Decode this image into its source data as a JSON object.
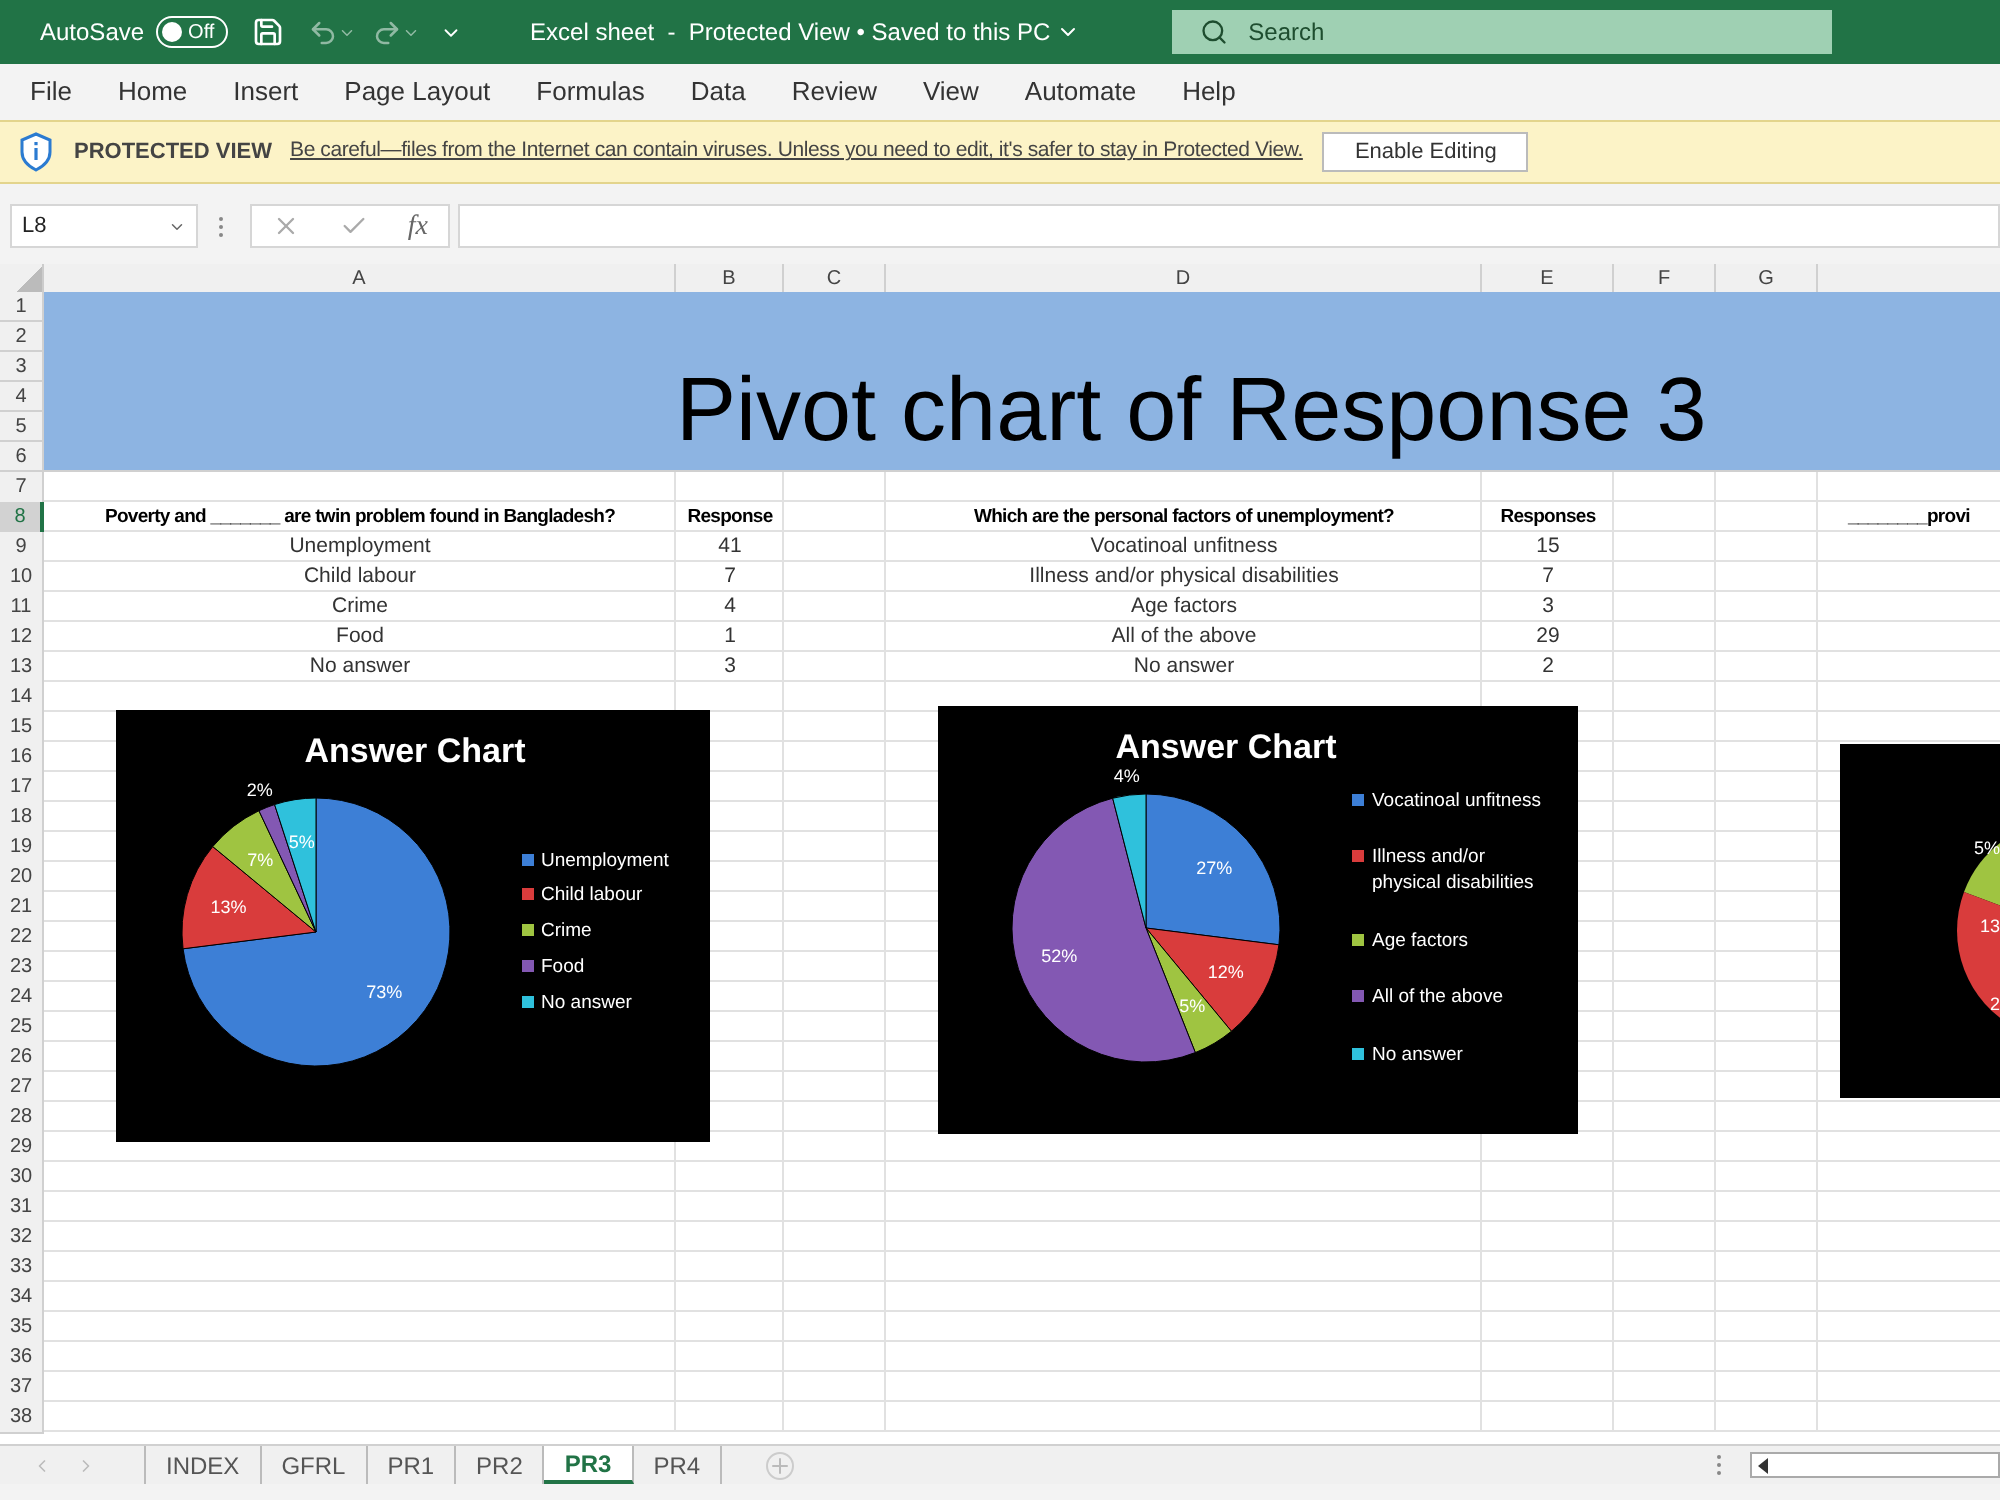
{
  "title_bar": {
    "autosave_label": "AutoSave",
    "autosave_toggle": {
      "label": "Off",
      "on": false
    },
    "title": "Excel sheet  -  Protected View • Saved to this PC",
    "search_placeholder": "Search"
  },
  "menu": [
    "File",
    "Home",
    "Insert",
    "Page Layout",
    "Formulas",
    "Data",
    "Review",
    "View",
    "Automate",
    "Help"
  ],
  "protected_bar": {
    "label": "PROTECTED VIEW",
    "message": "Be careful—files from the Internet can contain viruses. Unless you need to edit, it's safer to stay in Protected View.",
    "button": "Enable Editing"
  },
  "formula_bar": {
    "name_box": "L8",
    "fx": "fx"
  },
  "columns": [
    "A",
    "B",
    "C",
    "D",
    "E",
    "F",
    "G"
  ],
  "banner": {
    "title": "Pivot chart of Response 3"
  },
  "rows": [
    {
      "number": "1",
      "selected": false
    },
    {
      "number": "2",
      "selected": false
    },
    {
      "number": "3",
      "selected": false
    },
    {
      "number": "4",
      "selected": false
    },
    {
      "number": "5",
      "selected": false
    },
    {
      "number": "6",
      "selected": false
    },
    {
      "number": "7",
      "selected": false
    },
    {
      "number": "8",
      "selected": true,
      "kind": "header",
      "cells": {
        "A": "Poverty and _______ are twin problem found in Bangladesh?",
        "B": "Response",
        "D": "Which are the personal factors of unemployment?",
        "E": "Responses",
        "H": "________provi"
      }
    },
    {
      "number": "9",
      "selected": false,
      "kind": "data",
      "cells": {
        "A": "Unemployment",
        "B": "41",
        "D": "Vocatinoal unfitness",
        "E": "15"
      }
    },
    {
      "number": "10",
      "selected": false,
      "kind": "data",
      "cells": {
        "A": "Child labour",
        "B": "7",
        "D": "Illness and/or physical disabilities",
        "E": "7"
      }
    },
    {
      "number": "11",
      "selected": false,
      "kind": "data",
      "cells": {
        "A": "Crime",
        "B": "4",
        "D": "Age factors",
        "E": "3"
      }
    },
    {
      "number": "12",
      "selected": false,
      "kind": "data",
      "cells": {
        "A": "Food",
        "B": "1",
        "D": "All of the above",
        "E": "29"
      }
    },
    {
      "number": "13",
      "selected": false,
      "kind": "data",
      "cells": {
        "A": "No answer",
        "B": "3",
        "D": "No answer",
        "E": "2"
      }
    },
    {
      "number": "14",
      "selected": false
    },
    {
      "number": "15",
      "selected": false
    },
    {
      "number": "16",
      "selected": false
    },
    {
      "number": "17",
      "selected": false
    },
    {
      "number": "18",
      "selected": false
    },
    {
      "number": "19",
      "selected": false
    },
    {
      "number": "20",
      "selected": false
    },
    {
      "number": "21",
      "selected": false
    },
    {
      "number": "22",
      "selected": false
    },
    {
      "number": "23",
      "selected": false
    },
    {
      "number": "24",
      "selected": false
    },
    {
      "number": "25",
      "selected": false
    },
    {
      "number": "26",
      "selected": false
    },
    {
      "number": "27",
      "selected": false
    },
    {
      "number": "28",
      "selected": false
    },
    {
      "number": "29",
      "selected": false
    },
    {
      "number": "30",
      "selected": false
    },
    {
      "number": "31",
      "selected": false
    },
    {
      "number": "32",
      "selected": false
    },
    {
      "number": "33",
      "selected": false
    },
    {
      "number": "34",
      "selected": false
    },
    {
      "number": "35",
      "selected": false
    },
    {
      "number": "36",
      "selected": false
    },
    {
      "number": "37",
      "selected": false
    },
    {
      "number": "38",
      "selected": false
    }
  ],
  "charts": [
    {
      "chart_data": {
        "type": "pie",
        "title": "Answer Chart",
        "categories": [
          "Unemployment",
          "Child labour",
          "Crime",
          "Food",
          "No answer"
        ],
        "series": [
          {
            "values": [
              73,
              13,
              7,
              2,
              5
            ]
          }
        ],
        "value_labels": [
          "73%",
          "13%",
          "7%",
          "2%",
          "5%"
        ],
        "legend": "right"
      }
    },
    {
      "chart_data": {
        "type": "pie",
        "title": "Answer Chart",
        "categories": [
          "Vocatinoal unfitness",
          "Illness and/or physical disabilities",
          "Age factors",
          "All of the above",
          "No answer"
        ],
        "series": [
          {
            "values": [
              27,
              12,
              5,
              52,
              4
            ]
          }
        ],
        "value_labels": [
          "27%",
          "12%",
          "5%",
          "52%",
          "4%"
        ],
        "legend": "right"
      }
    }
  ],
  "partial_chart": {
    "labels": [
      "5%",
      "13",
      "2"
    ]
  },
  "sheet_tabs": [
    {
      "label": "INDEX",
      "selected": false
    },
    {
      "label": "GFRL",
      "selected": false
    },
    {
      "label": "PR1",
      "selected": false
    },
    {
      "label": "PR2",
      "selected": false
    },
    {
      "label": "PR3",
      "selected": true
    },
    {
      "label": "PR4",
      "selected": false
    }
  ]
}
